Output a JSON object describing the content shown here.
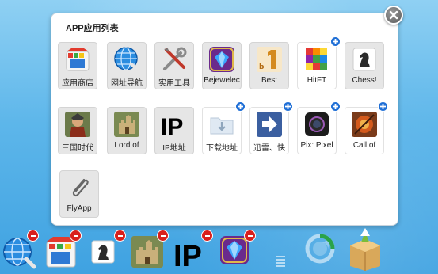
{
  "panel": {
    "title": "APP应用列表"
  },
  "apps": [
    {
      "label": "应用商店",
      "icon": "app-store-icon",
      "added": false
    },
    {
      "label": "网址导航",
      "icon": "web-nav-globe-icon",
      "added": false
    },
    {
      "label": "实用工具",
      "icon": "tools-icon",
      "added": false
    },
    {
      "label": "Bejewelec",
      "icon": "bejeweled-gem-icon",
      "added": false
    },
    {
      "label": "Best",
      "icon": "best-game-icon",
      "added": false
    },
    {
      "label": "HitFT",
      "icon": "hitft-grid-icon",
      "added": false,
      "addable": true
    },
    {
      "label": "Chess!",
      "icon": "chess-knight-icon",
      "added": false
    },
    {
      "label": "三国时代",
      "icon": "three-kingdoms-icon",
      "added": false
    },
    {
      "label": "Lord of",
      "icon": "lord-of-castle-icon",
      "added": false
    },
    {
      "label": "IP地址",
      "icon": "ip-address-icon",
      "added": false
    },
    {
      "label": "下载地址",
      "icon": "download-folder-icon",
      "added": false,
      "addable": true
    },
    {
      "label": "迅雷、快",
      "icon": "thunder-arrow-icon",
      "added": false,
      "addable": true
    },
    {
      "label": "Pix: Pixel",
      "icon": "pix-camera-icon",
      "added": false,
      "addable": true
    },
    {
      "label": "Call of",
      "icon": "call-of-game-icon",
      "added": false,
      "addable": true
    },
    {
      "label": "FlyApp",
      "icon": "paperclip-icon",
      "added": false
    }
  ],
  "dock": [
    {
      "icon": "web-nav-globe-icon"
    },
    {
      "icon": "app-store-icon"
    },
    {
      "icon": "chess-knight-icon"
    },
    {
      "icon": "lord-of-castle-icon"
    },
    {
      "icon": "ip-address-icon"
    },
    {
      "icon": "bejeweled-gem-icon"
    }
  ],
  "colors": {
    "background": "#5db6ea",
    "panel": "#ffffff",
    "plus_badge": "#1f6fd6",
    "minus_badge": "#d8201d"
  }
}
